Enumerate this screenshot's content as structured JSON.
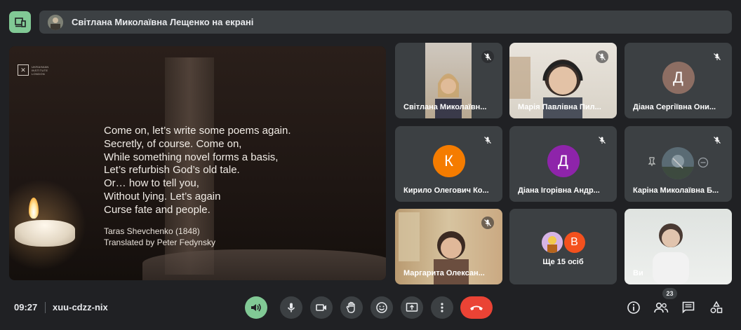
{
  "banner": {
    "text": "Світлана Миколаївна Лещенко на екрані"
  },
  "presentation": {
    "logo_lines": [
      "UKRAINIAN",
      "INSTITUTE",
      "LONDON"
    ],
    "poem": [
      "Come on, let’s write some poems again.",
      "Secretly, of course. Come on,",
      "While something novel forms a basis,",
      "Let’s refurbish God’s old tale.",
      "Or… how to tell you,",
      "Without lying. Let’s again",
      "Curse fate and people."
    ],
    "attribution": [
      "Taras Shevchenko (1848)",
      "Translated by Peter Fedynsky"
    ]
  },
  "participants": [
    {
      "name": "Світлана Миколаївн...",
      "type": "video"
    },
    {
      "name": "Марія Павлівна Пил...",
      "type": "video"
    },
    {
      "name": "Діана Сергіївна Они...",
      "type": "avatar",
      "letter": "Д",
      "color": "#8d6e63"
    },
    {
      "name": "Кирило Олегович Ко...",
      "type": "avatar",
      "letter": "К",
      "color": "#f57c00"
    },
    {
      "name": "Діана Ігорівна Андр...",
      "type": "avatar",
      "letter": "Д",
      "color": "#8e24aa"
    },
    {
      "name": "Каріна Миколаївна Б...",
      "type": "photo"
    },
    {
      "name": "Маргарита Олексан...",
      "type": "video"
    },
    {
      "name": "Ви",
      "type": "video"
    }
  ],
  "more": {
    "letter": "В",
    "color": "#f4511e",
    "text": "Ще 15 осіб"
  },
  "bottom": {
    "time": "09:27",
    "code": "xuu-cdzz-nix",
    "participant_count": "23"
  },
  "colors": {
    "accent": "#81c995",
    "end_call": "#ea4335",
    "tile": "#3c4043",
    "bg": "#202124"
  }
}
